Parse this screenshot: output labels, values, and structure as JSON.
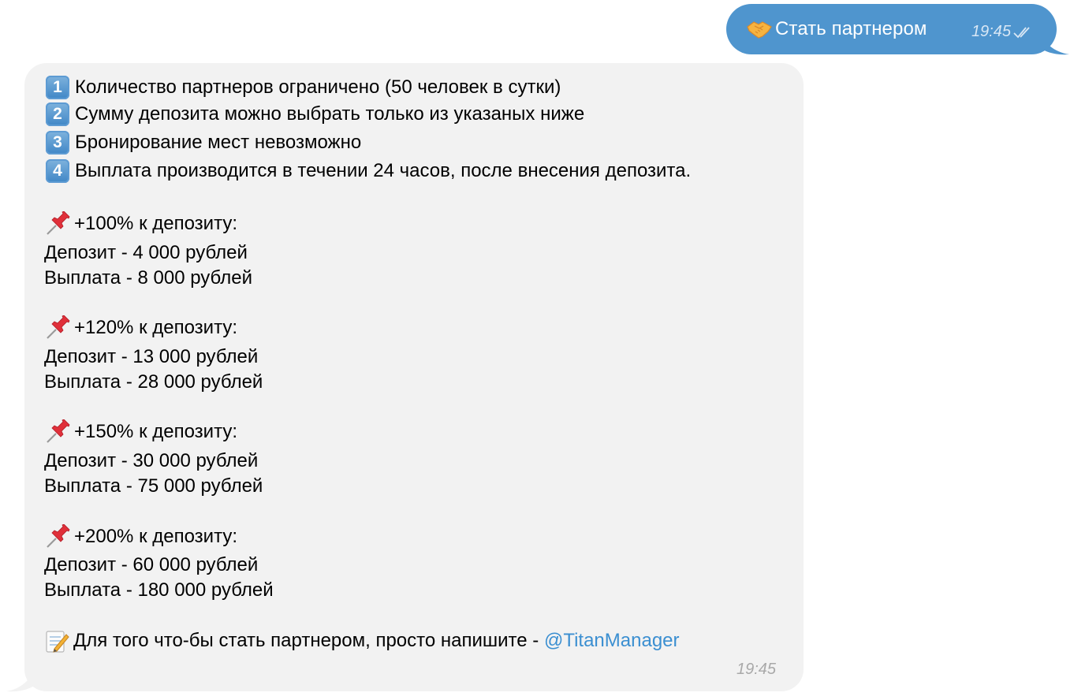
{
  "outgoing": {
    "emoji": "handshake-icon",
    "text": "Стать партнером",
    "time": "19:45",
    "status": "read",
    "bubble_color": "#4f95ce"
  },
  "incoming": {
    "bubble_color": "#f2f2f2",
    "rules": [
      {
        "key": "1",
        "text": "Количество партнеров ограничено (50 человек в сутки)"
      },
      {
        "key": "2",
        "text": "Сумму депозита можно выбрать только из указаных ниже"
      },
      {
        "key": "3",
        "text": "Бронирование мест невозможно"
      },
      {
        "key": "4",
        "text": "Выплата производится в течении 24 часов, после внесения депозита."
      }
    ],
    "plans": [
      {
        "title": "+100% к депозиту:",
        "deposit": "Депозит - 4 000 рублей",
        "payout": "Выплата - 8 000 рублей"
      },
      {
        "title": "+120% к депозиту:",
        "deposit": "Депозит - 13 000 рублей",
        "payout": "Выплата - 28 000 рублей"
      },
      {
        "title": "+150% к депозиту:",
        "deposit": "Депозит - 30 000 рублей",
        "payout": "Выплата - 75 000 рублей"
      },
      {
        "title": "+200% к депозиту:",
        "deposit": "Депозит - 60 000 рублей",
        "payout": "Выплата - 180 000 рублей"
      }
    ],
    "footer": {
      "text": "Для того что-бы стать партнером, просто напишите - ",
      "mention": "@TitanManager",
      "mention_color": "#3b8fd1"
    },
    "time": "19:45"
  }
}
